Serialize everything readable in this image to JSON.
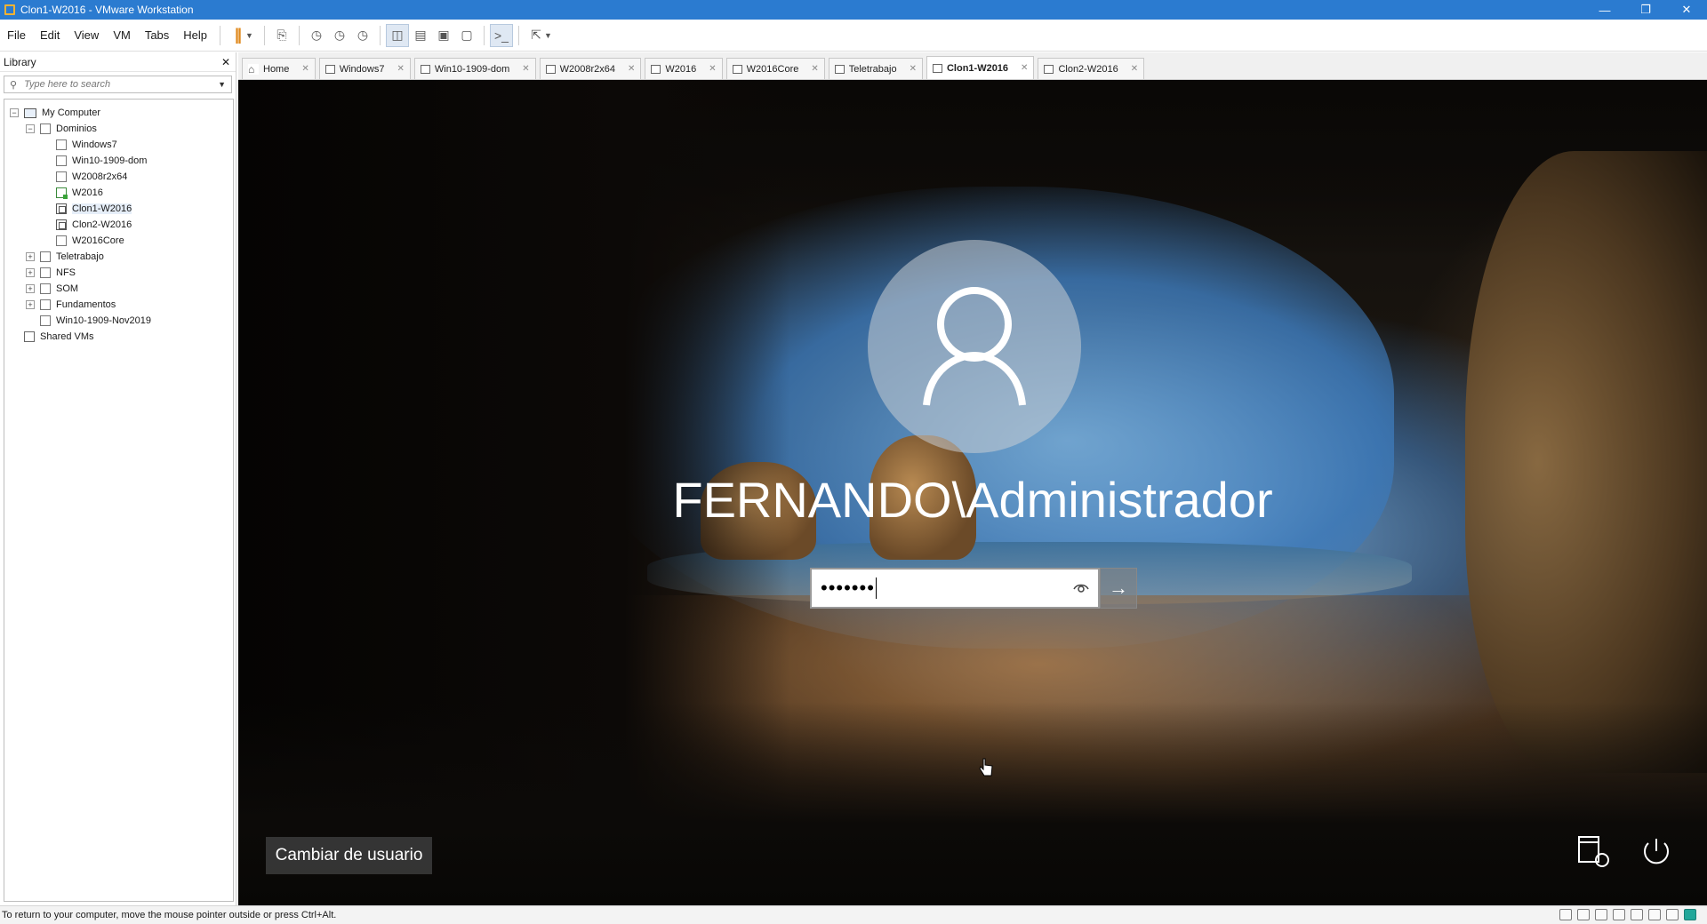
{
  "window": {
    "title": "Clon1-W2016 - VMware Workstation",
    "controls": [
      "minimize",
      "restore",
      "close"
    ]
  },
  "menu": [
    "File",
    "Edit",
    "View",
    "VM",
    "Tabs",
    "Help"
  ],
  "toolbar": {
    "buttons": [
      "pause-icon",
      "send-keys-icon",
      "snapshot-icon",
      "revert-icon",
      "snapshot-manager-icon",
      "sidebar-toggle-icon",
      "thumbnail-icon",
      "fullscreen-icon",
      "unity-icon",
      "console-icon",
      "stretch-icon"
    ]
  },
  "library": {
    "title": "Library",
    "search_placeholder": "Type here to search",
    "tree": [
      {
        "label": "My Computer",
        "level": 0,
        "expander": "-",
        "icon": "computer"
      },
      {
        "label": "Dominios",
        "level": 1,
        "expander": "-",
        "icon": "folder"
      },
      {
        "label": "Windows7",
        "level": 2,
        "expander": "",
        "icon": "vm"
      },
      {
        "label": "Win10-1909-dom",
        "level": 2,
        "expander": "",
        "icon": "vm"
      },
      {
        "label": "W2008r2x64",
        "level": 2,
        "expander": "",
        "icon": "vm"
      },
      {
        "label": "W2016",
        "level": 2,
        "expander": "",
        "icon": "running"
      },
      {
        "label": "Clon1-W2016",
        "level": 2,
        "expander": "",
        "icon": "clone",
        "selected": true
      },
      {
        "label": "Clon2-W2016",
        "level": 2,
        "expander": "",
        "icon": "clone"
      },
      {
        "label": "W2016Core",
        "level": 2,
        "expander": "",
        "icon": "vm"
      },
      {
        "label": "Teletrabajo",
        "level": 1,
        "expander": "+",
        "icon": "folder"
      },
      {
        "label": "NFS",
        "level": 1,
        "expander": "+",
        "icon": "folder"
      },
      {
        "label": "SOM",
        "level": 1,
        "expander": "+",
        "icon": "folder"
      },
      {
        "label": "Fundamentos",
        "level": 1,
        "expander": "+",
        "icon": "folder"
      },
      {
        "label": "Win10-1909-Nov2019",
        "level": 1,
        "expander": "",
        "icon": "vm"
      },
      {
        "label": "Shared VMs",
        "level": 0,
        "expander": "",
        "icon": "shared"
      }
    ]
  },
  "tabs": [
    {
      "label": "Home",
      "icon": "home"
    },
    {
      "label": "Windows7",
      "icon": "vm"
    },
    {
      "label": "Win10-1909-dom",
      "icon": "vm"
    },
    {
      "label": "W2008r2x64",
      "icon": "vm"
    },
    {
      "label": "W2016",
      "icon": "vm"
    },
    {
      "label": "W2016Core",
      "icon": "vm"
    },
    {
      "label": "Teletrabajo",
      "icon": "vm"
    },
    {
      "label": "Clon1-W2016",
      "icon": "clone",
      "active": true
    },
    {
      "label": "Clon2-W2016",
      "icon": "clone"
    }
  ],
  "login": {
    "username": "FERNANDO\\Administrador",
    "password_mask": "•••••••",
    "switch_user": "Cambiar de usuario"
  },
  "status": {
    "text": "To return to your computer, move the mouse pointer outside or press Ctrl+Alt."
  },
  "colors": {
    "titlebar": "#2b7bd0",
    "pause": "#e08a1e"
  }
}
